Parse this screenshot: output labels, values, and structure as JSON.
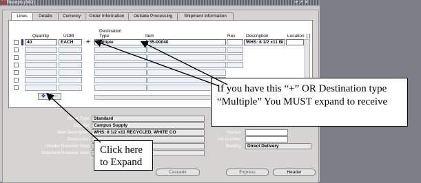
{
  "window": {
    "title": "Receipts (MIO)",
    "controls": "≡ ↗ ✕"
  },
  "tabs": [
    "Lines",
    "Details",
    "Currency",
    "Order Information",
    "Outside Processing",
    "Shipment Information"
  ],
  "table": {
    "headers": {
      "quantity": "Quantity",
      "uom": "UOM",
      "destination": "Destination\nType",
      "item": "Item",
      "rev": "Rev",
      "description": "Description",
      "location": "Location",
      "flex": "[ ]"
    },
    "row1": {
      "quantity": "40",
      "uom": "EACH",
      "plus": "+",
      "destination": "Multiple",
      "item": "55-00040",
      "rev": "",
      "description": "WHS: 8 1/2 x11 BI",
      "location": ""
    }
  },
  "expand_button": {
    "label": "❖"
  },
  "collapse_button": {
    "label": "–"
  },
  "form": {
    "order_type_label": "Order Type",
    "order_type": "Standard",
    "supplier_label": "Supplier",
    "supplier": "Campus Supply",
    "item_desc_label": "Item Description",
    "item_desc": "WHS: 8 1/2 x11 RECYCLED, WHITE CO",
    "destination_label": "Destination",
    "header_note_label": "Header Receiver Note",
    "shipment_note_label": "Shipment Receiver Note",
    "hazard_label": "Hazard",
    "un_number_label": "UN Number",
    "routing_label": "Routing",
    "routing": "Direct Delivery"
  },
  "buttons": {
    "cascade": "Cascade",
    "express": "Express",
    "header": "Header"
  },
  "callouts": {
    "expand_text": "If you have this “+” OR Destination type “Multiple”  You MUST expand to receive",
    "click_text": "Click here to Expand"
  }
}
